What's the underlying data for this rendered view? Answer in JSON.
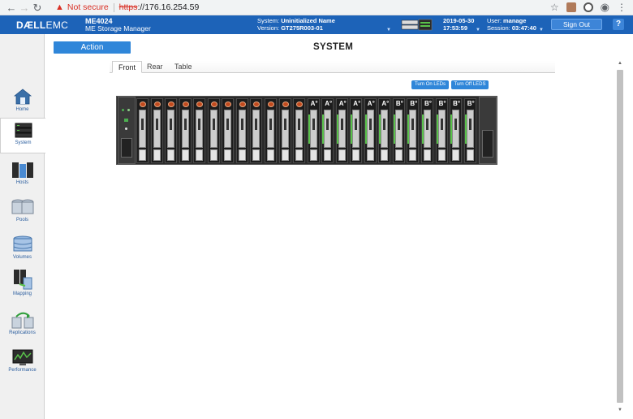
{
  "browser": {
    "not_secure": "Not secure",
    "url_scheme": "https",
    "url_rest": "://176.16.254.59"
  },
  "header": {
    "brand_dell": "DÆLL",
    "brand_emc": "EMC",
    "model": "ME4024",
    "product": "ME Storage Manager",
    "system_label": "System:",
    "system_name": "Uninitialized Name",
    "version_label": "Version:",
    "version": "GT275R003-01",
    "date": "2019-05-30",
    "time": "17:53:59",
    "user_label": "User:",
    "user": "manage",
    "session_label": "Session:",
    "session": "03:47:40",
    "signout_label": "Sign Out",
    "help_label": "?"
  },
  "sidebar": {
    "items": [
      {
        "label": "Home",
        "icon": "home-icon"
      },
      {
        "label": "System",
        "icon": "system-icon"
      },
      {
        "label": "Hosts",
        "icon": "hosts-icon"
      },
      {
        "label": "Pools",
        "icon": "pools-icon"
      },
      {
        "label": "Volumes",
        "icon": "volumes-icon"
      },
      {
        "label": "Mapping",
        "icon": "mapping-icon"
      },
      {
        "label": "Replications",
        "icon": "replications-icon"
      },
      {
        "label": "Performance",
        "icon": "performance-icon"
      }
    ],
    "active": "System"
  },
  "main": {
    "action_label": "Action",
    "title": "SYSTEM",
    "tabs": [
      {
        "label": "Front"
      },
      {
        "label": "Rear"
      },
      {
        "label": "Table"
      }
    ],
    "active_tab": "Front",
    "leds_on_label": "Turn On LEDs",
    "leds_off_label": "Turn Off LEDS"
  },
  "enclosure": {
    "bay_count": 24,
    "pools": [
      "",
      "",
      "",
      "",
      "",
      "",
      "",
      "",
      "",
      "",
      "",
      "",
      "A",
      "A",
      "A",
      "A",
      "A",
      "A",
      "B",
      "B",
      "B",
      "B",
      "B",
      "B"
    ]
  },
  "colors": {
    "header_blue": "#1d63b8",
    "button_blue": "#2f86d9",
    "pool_green": "#59c24a",
    "latch_orange": "#c14a1e"
  }
}
